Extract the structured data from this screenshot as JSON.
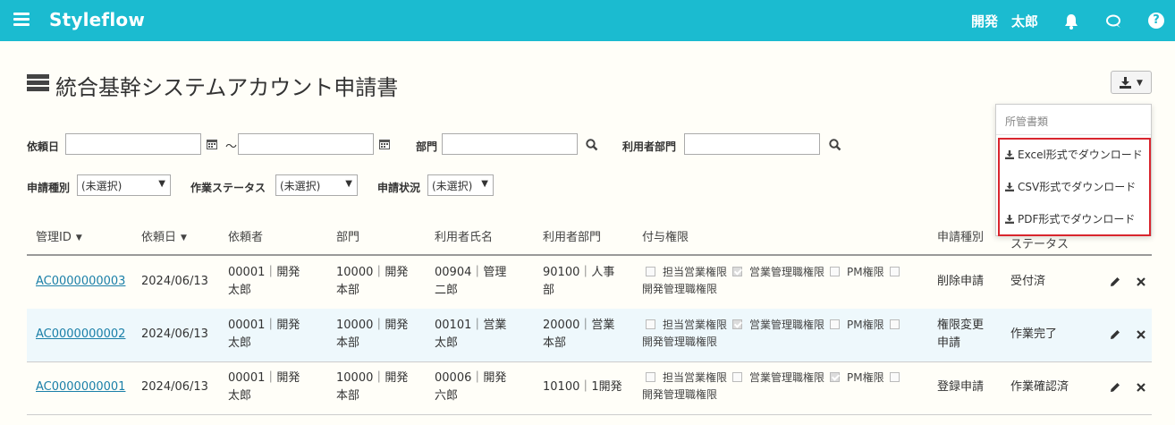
{
  "header": {
    "brand": "Styleflow",
    "user": "開発　太郎",
    "help_glyph": "?"
  },
  "page": {
    "title": "統合基幹システムアカウント申請書"
  },
  "download_menu": {
    "header": "所管書類",
    "items": [
      {
        "label": "Excel形式でダウンロード"
      },
      {
        "label": "CSV形式でダウンロード"
      },
      {
        "label": "PDF形式でダウンロード"
      }
    ]
  },
  "filters": {
    "request_date_label": "依頼日",
    "date_from": "",
    "date_to": "",
    "range_sep": "～",
    "department_label": "部門",
    "department_value": "",
    "user_department_label": "利用者部門",
    "user_department_value": "",
    "request_type_label": "申請種別",
    "request_type_value": "(未選択)",
    "work_status_label": "作業ステータス",
    "work_status_value": "(未選択)",
    "request_status_label": "申請状況",
    "request_status_value": "(未選択)"
  },
  "table": {
    "columns": [
      "管理ID",
      "依頼日",
      "依頼者",
      "部門",
      "利用者氏名",
      "利用者部門",
      "付与権限",
      "申請種別",
      "ステータス"
    ],
    "rows": [
      {
        "id": "AC0000000003",
        "date": "2024/06/13",
        "requester": [
          "00001｜開発",
          "太郎"
        ],
        "department": [
          "10000｜開発",
          "本部"
        ],
        "user_name": [
          "00904｜管理",
          "二郎"
        ],
        "user_department": [
          "90100｜人事",
          "部"
        ],
        "permissions": [
          {
            "label": "担当営業権限",
            "checked": false
          },
          {
            "label": "営業管理職権限",
            "checked": true
          },
          {
            "label": "PM権限",
            "checked": false
          },
          {
            "label": "開発管理職権限",
            "checked": false
          }
        ],
        "request_type": [
          "削除申請"
        ],
        "status": "受付済"
      },
      {
        "id": "AC0000000002",
        "date": "2024/06/13",
        "requester": [
          "00001｜開発",
          "太郎"
        ],
        "department": [
          "10000｜開発",
          "本部"
        ],
        "user_name": [
          "00101｜営業",
          "太郎"
        ],
        "user_department": [
          "20000｜営業",
          "本部"
        ],
        "permissions": [
          {
            "label": "担当営業権限",
            "checked": false
          },
          {
            "label": "営業管理職権限",
            "checked": true
          },
          {
            "label": "PM権限",
            "checked": false
          },
          {
            "label": "開発管理職権限",
            "checked": false
          }
        ],
        "request_type": [
          "権限変更",
          "申請"
        ],
        "status": "作業完了"
      },
      {
        "id": "AC0000000001",
        "date": "2024/06/13",
        "requester": [
          "00001｜開発",
          "太郎"
        ],
        "department": [
          "10000｜開発",
          "本部"
        ],
        "user_name": [
          "00006｜開発",
          "六郎"
        ],
        "user_department": [
          "10100｜1開発"
        ],
        "permissions": [
          {
            "label": "担当営業権限",
            "checked": false
          },
          {
            "label": "営業管理職権限",
            "checked": false
          },
          {
            "label": "PM権限",
            "checked": true
          },
          {
            "label": "開発管理職権限",
            "checked": false
          }
        ],
        "request_type": [
          "登録申請"
        ],
        "status": "作業確認済"
      }
    ]
  },
  "colors": {
    "topbar": "#1bbbd0",
    "link": "#1a7fa8",
    "alt_row": "#eef8fc",
    "highlight": "#d9252e"
  }
}
